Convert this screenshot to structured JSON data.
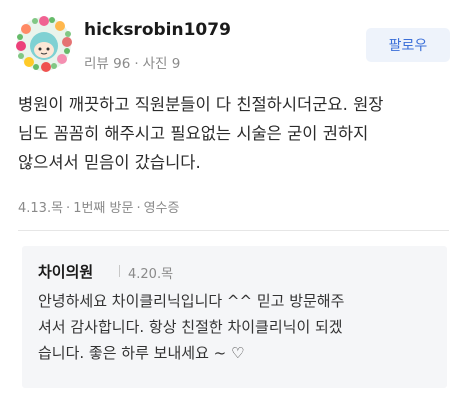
{
  "profile": {
    "username": "hicksrobin1079",
    "review_count": "리뷰 96",
    "separator": "·",
    "photo_count": "사진 9",
    "follow_label": "팔로우"
  },
  "review": {
    "lines": [
      "병원이 깨끗하고 직원분들이 다 친절하시더군요. 원장",
      "님도 꼼꼼히 해주시고 필요없는 시술은 굳이 권하지",
      "않으셔서 믿음이 갔습니다."
    ],
    "date": "4.13.목",
    "visit": "1번째 방문",
    "receipt": "영수증",
    "separator": "·"
  },
  "reply": {
    "author": "차이의원",
    "date": "4.20.목",
    "lines": [
      "안녕하세요 차이클리닉입니다 ^^ 믿고 방문해주",
      "셔서 감사합니다. 항상 친절한 차이클리닉이 되겠",
      "습니다. 좋은 하루 보내세요 ~ ♡"
    ]
  },
  "colors": {
    "accent": "#3b6fd8",
    "muted": "#8a8a8a",
    "reply_bg": "#f5f6f8"
  }
}
